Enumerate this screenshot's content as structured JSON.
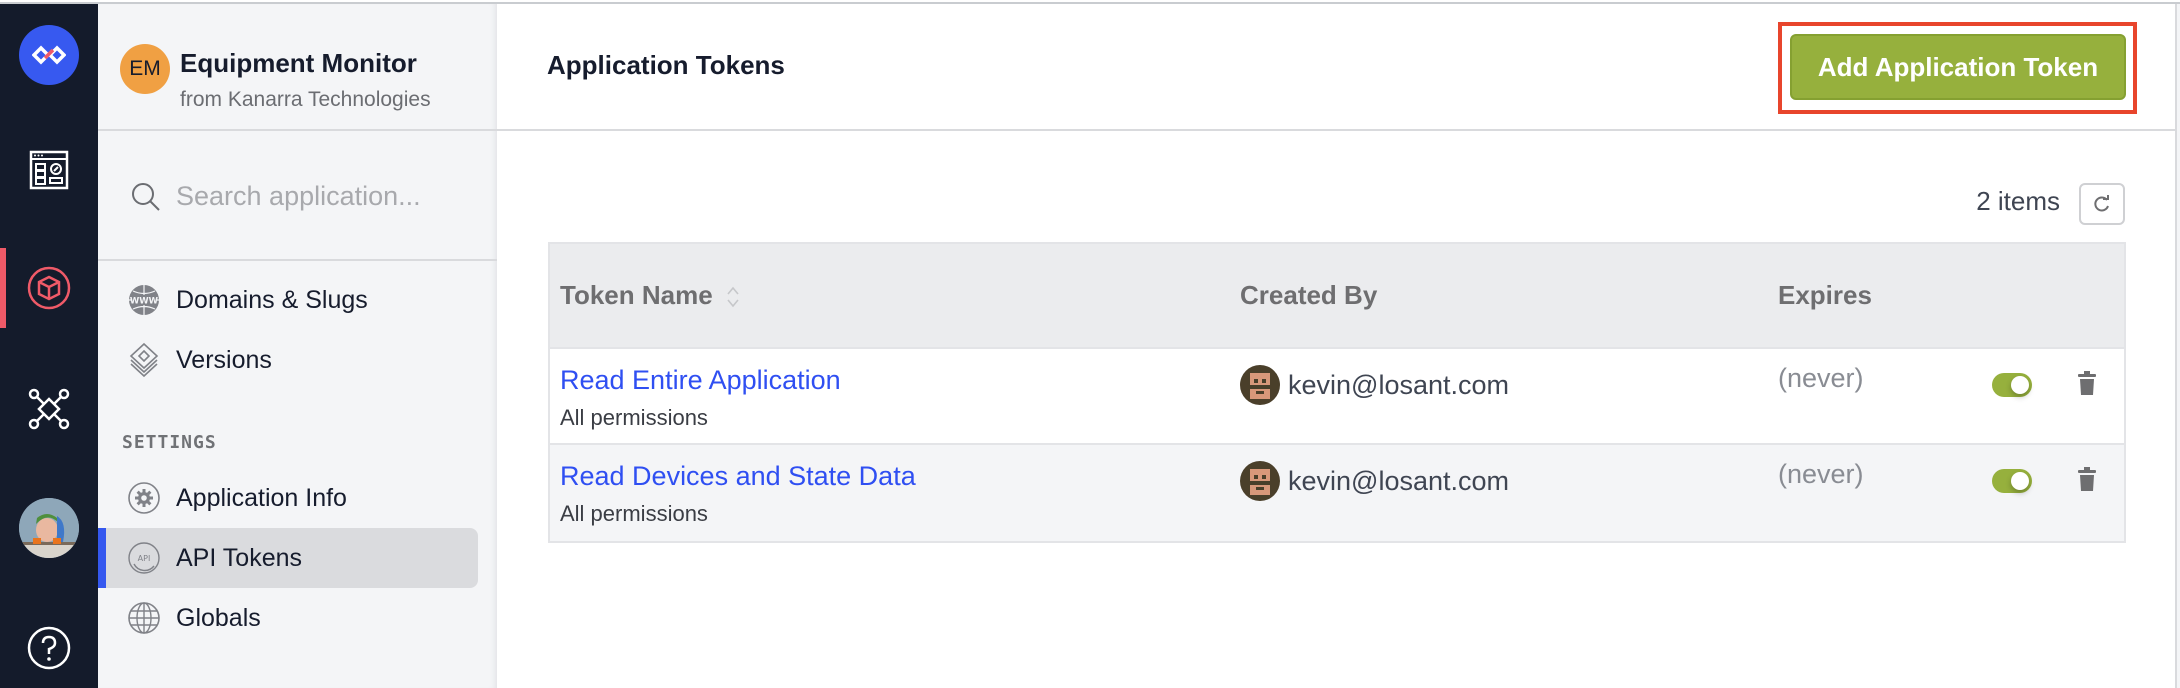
{
  "rail": {
    "items": [
      {
        "name": "logo",
        "icon": "losant-logo-icon"
      },
      {
        "name": "dashboards",
        "icon": "dashboard-icon"
      },
      {
        "name": "applications",
        "icon": "cube-icon",
        "active": true
      },
      {
        "name": "edge-compute",
        "icon": "network-icon"
      },
      {
        "name": "user-profile",
        "icon": "user-avatar"
      },
      {
        "name": "help",
        "icon": "help-icon"
      }
    ],
    "active_color": "#ef5a68"
  },
  "sidebar": {
    "app_badge": "EM",
    "app_name": "Equipment Monitor",
    "app_org": "from Kanarra Technologies",
    "search_placeholder": "Search application...",
    "items": [
      {
        "label": "Domains & Slugs",
        "icon": "www-globe-icon"
      },
      {
        "label": "Versions",
        "icon": "layers-icon"
      }
    ],
    "settings_label": "SETTINGS",
    "settings_items": [
      {
        "label": "Application Info",
        "icon": "gear-icon"
      },
      {
        "label": "API Tokens",
        "icon": "api-icon",
        "active": true
      },
      {
        "label": "Globals",
        "icon": "globe-icon"
      }
    ]
  },
  "main": {
    "title": "Application Tokens",
    "add_button": "Add Application Token",
    "items_count": "2 items",
    "columns": [
      "Token Name",
      "Created By",
      "Expires"
    ],
    "rows": [
      {
        "name": "Read Entire Application",
        "permissions": "All permissions",
        "created_by": "kevin@losant.com",
        "expires": "(never)",
        "enabled": true
      },
      {
        "name": "Read Devices and State Data",
        "permissions": "All permissions",
        "created_by": "kevin@losant.com",
        "expires": "(never)",
        "enabled": true
      }
    ]
  },
  "colors": {
    "accent_blue": "#3558ef",
    "button_green": "#96b03d",
    "link_blue": "#2f4ff2",
    "highlight_red": "#e8452c",
    "rail_bg": "#141b2b"
  }
}
